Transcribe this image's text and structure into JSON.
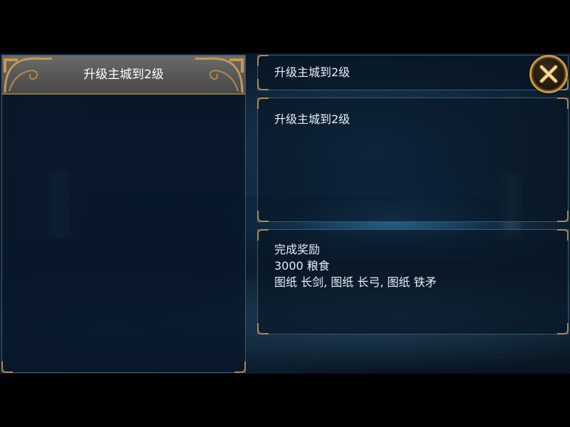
{
  "left_panel": {
    "title": "升级主城到2级"
  },
  "quest": {
    "title": "升级主城到2级",
    "description": "升级主城到2级"
  },
  "reward": {
    "heading": "完成奖励",
    "resource": "3000 粮食",
    "items": "图纸 长剑, 图纸 长弓, 图纸 铁矛"
  },
  "icons": {
    "close": "close-icon",
    "ornament": "gold-filigree-ornament"
  },
  "colors": {
    "frame_gold": "#b0894a",
    "header_gray": "#5a5a5a",
    "panel_bg": "#08162a",
    "text": "#e8eef4"
  }
}
